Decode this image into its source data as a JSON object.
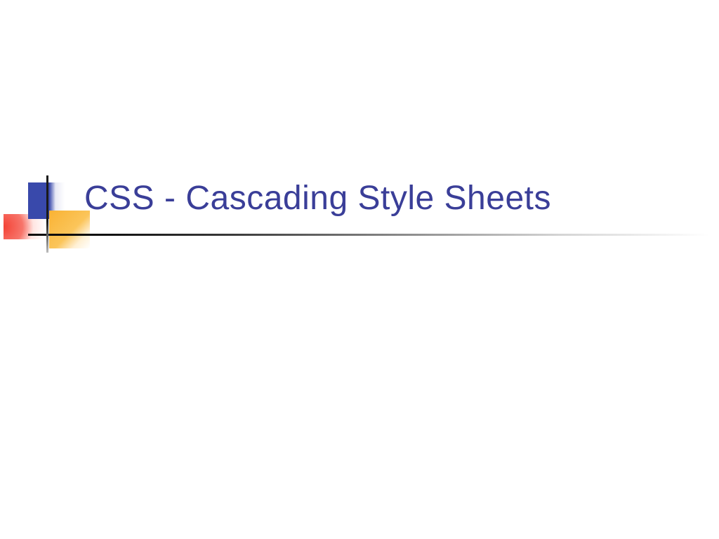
{
  "slide": {
    "title": "CSS - Cascading Style Sheets"
  }
}
